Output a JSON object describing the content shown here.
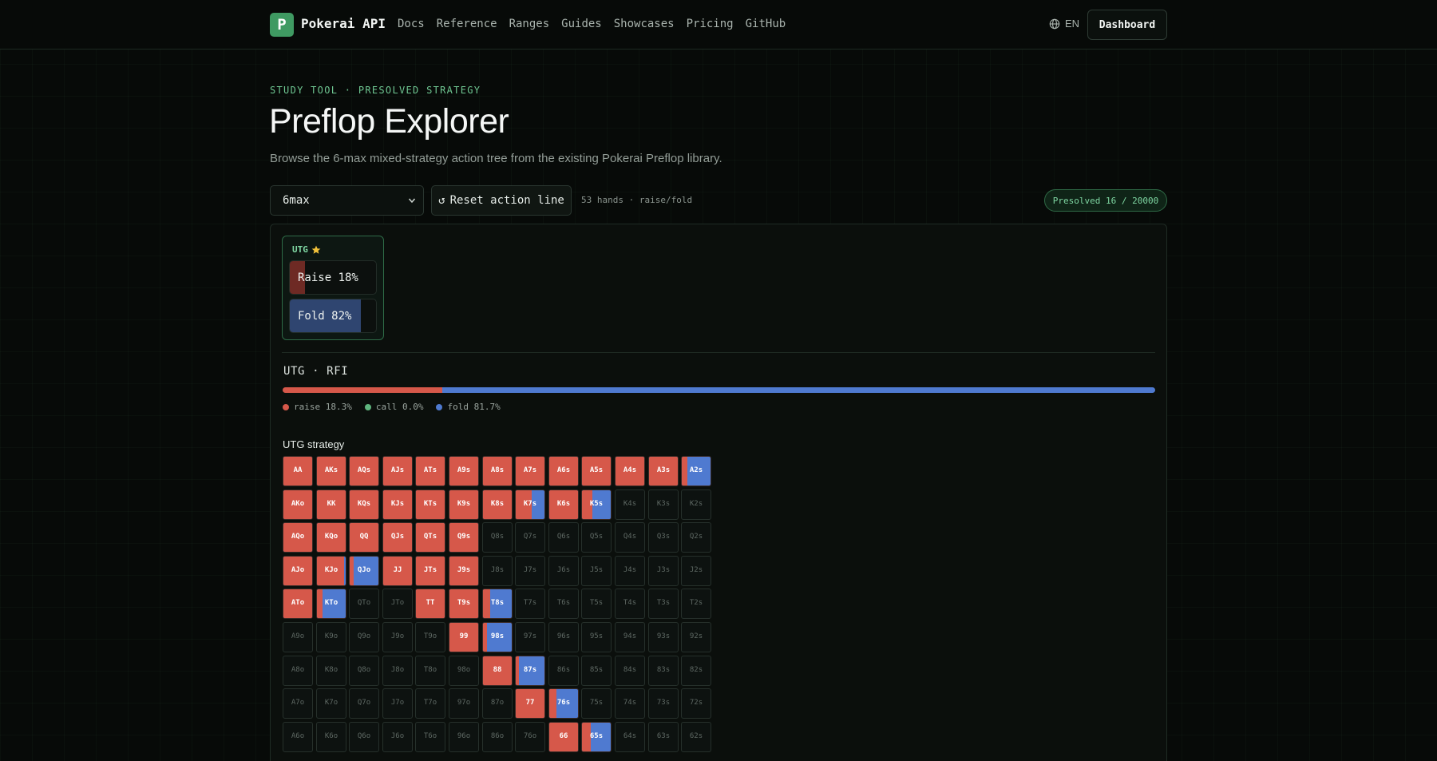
{
  "nav": {
    "logo_letter": "P",
    "brand": "Pokerai API",
    "links": [
      "Docs",
      "Reference",
      "Ranges",
      "Guides",
      "Showcases",
      "Pricing",
      "GitHub"
    ],
    "lang": "EN",
    "dashboard_label": "Dashboard"
  },
  "header": {
    "eyebrow": "STUDY TOOL · PRESOLVED STRATEGY",
    "title": "Preflop Explorer",
    "subtitle": "Browse the 6-max mixed-strategy action tree from the existing Pokerai Preflop library."
  },
  "controls": {
    "format_value": "6max",
    "reset_label": "Reset action line",
    "hands_info": "53 hands · raise/fold",
    "presolved": "Presolved 16 / 20000"
  },
  "node": {
    "position": "UTG",
    "actions": [
      {
        "label": "Raise 18%",
        "share": 0.18,
        "color": "#6e2a24"
      },
      {
        "label": "Fold 82%",
        "share": 0.82,
        "color": "#2f4570"
      }
    ]
  },
  "line": {
    "label": "UTG · RFI",
    "dist": [
      {
        "key": "raise",
        "label": "raise 18.3%",
        "share": 0.183,
        "color": "#d6584a"
      },
      {
        "key": "call",
        "label": "call 0.0%",
        "share": 0.0,
        "color": "#5fb57e"
      },
      {
        "key": "fold",
        "label": "fold 81.7%",
        "share": 0.817,
        "color": "#4f7ad0"
      }
    ]
  },
  "grid": {
    "title": "UTG strategy",
    "raise_color": "#d6584a",
    "fold_color": "#4f7ad0",
    "rows": [
      [
        [
          "AA",
          1
        ],
        [
          "AKs",
          1
        ],
        [
          "AQs",
          1
        ],
        [
          "AJs",
          1
        ],
        [
          "ATs",
          1
        ],
        [
          "A9s",
          1
        ],
        [
          "A8s",
          1
        ],
        [
          "A7s",
          1
        ],
        [
          "A6s",
          1
        ],
        [
          "A5s",
          1
        ],
        [
          "A4s",
          1
        ],
        [
          "A3s",
          1
        ],
        [
          "A2s",
          0.2
        ]
      ],
      [
        [
          "AKo",
          1
        ],
        [
          "KK",
          1
        ],
        [
          "KQs",
          1
        ],
        [
          "KJs",
          1
        ],
        [
          "KTs",
          1
        ],
        [
          "K9s",
          1
        ],
        [
          "K8s",
          1
        ],
        [
          "K7s",
          0.55
        ],
        [
          "K6s",
          1
        ],
        [
          "K5s",
          0.35
        ],
        [
          "K4s",
          0
        ],
        [
          "K3s",
          0
        ],
        [
          "K2s",
          0
        ]
      ],
      [
        [
          "AQo",
          1
        ],
        [
          "KQo",
          1
        ],
        [
          "QQ",
          1
        ],
        [
          "QJs",
          1
        ],
        [
          "QTs",
          1
        ],
        [
          "Q9s",
          1
        ],
        [
          "Q8s",
          0
        ],
        [
          "Q7s",
          0
        ],
        [
          "Q6s",
          0
        ],
        [
          "Q5s",
          0
        ],
        [
          "Q4s",
          0
        ],
        [
          "Q3s",
          0
        ],
        [
          "Q2s",
          0
        ]
      ],
      [
        [
          "AJo",
          1
        ],
        [
          "KJo",
          0.95
        ],
        [
          "QJo",
          0.15
        ],
        [
          "JJ",
          1
        ],
        [
          "JTs",
          1
        ],
        [
          "J9s",
          1
        ],
        [
          "J8s",
          0
        ],
        [
          "J7s",
          0
        ],
        [
          "J6s",
          0
        ],
        [
          "J5s",
          0
        ],
        [
          "J4s",
          0
        ],
        [
          "J3s",
          0
        ],
        [
          "J2s",
          0
        ]
      ],
      [
        [
          "ATo",
          1
        ],
        [
          "KTo",
          0.2
        ],
        [
          "QTo",
          0
        ],
        [
          "JTo",
          0
        ],
        [
          "TT",
          1
        ],
        [
          "T9s",
          1
        ],
        [
          "T8s",
          0.25
        ],
        [
          "T7s",
          0
        ],
        [
          "T6s",
          0
        ],
        [
          "T5s",
          0
        ],
        [
          "T4s",
          0
        ],
        [
          "T3s",
          0
        ],
        [
          "T2s",
          0
        ]
      ],
      [
        [
          "A9o",
          0
        ],
        [
          "K9o",
          0
        ],
        [
          "Q9o",
          0
        ],
        [
          "J9o",
          0
        ],
        [
          "T9o",
          0
        ],
        [
          "99",
          1
        ],
        [
          "98s",
          0.15
        ],
        [
          "97s",
          0
        ],
        [
          "96s",
          0
        ],
        [
          "95s",
          0
        ],
        [
          "94s",
          0
        ],
        [
          "93s",
          0
        ],
        [
          "92s",
          0
        ]
      ],
      [
        [
          "A8o",
          0
        ],
        [
          "K8o",
          0
        ],
        [
          "Q8o",
          0
        ],
        [
          "J8o",
          0
        ],
        [
          "T8o",
          0
        ],
        [
          "98o",
          0
        ],
        [
          "88",
          1
        ],
        [
          "87s",
          0.1
        ],
        [
          "86s",
          0
        ],
        [
          "85s",
          0
        ],
        [
          "84s",
          0
        ],
        [
          "83s",
          0
        ],
        [
          "82s",
          0
        ]
      ],
      [
        [
          "A7o",
          0
        ],
        [
          "K7o",
          0
        ],
        [
          "Q7o",
          0
        ],
        [
          "J7o",
          0
        ],
        [
          "T7o",
          0
        ],
        [
          "97o",
          0
        ],
        [
          "87o",
          0
        ],
        [
          "77",
          1
        ],
        [
          "76s",
          0.25
        ],
        [
          "75s",
          0
        ],
        [
          "74s",
          0
        ],
        [
          "73s",
          0
        ],
        [
          "72s",
          0
        ]
      ],
      [
        [
          "A6o",
          0
        ],
        [
          "K6o",
          0
        ],
        [
          "Q6o",
          0
        ],
        [
          "J6o",
          0
        ],
        [
          "T6o",
          0
        ],
        [
          "96o",
          0
        ],
        [
          "86o",
          0
        ],
        [
          "76o",
          0
        ],
        [
          "66",
          1
        ],
        [
          "65s",
          0.3
        ],
        [
          "64s",
          0
        ],
        [
          "63s",
          0
        ],
        [
          "62s",
          0
        ]
      ]
    ]
  }
}
